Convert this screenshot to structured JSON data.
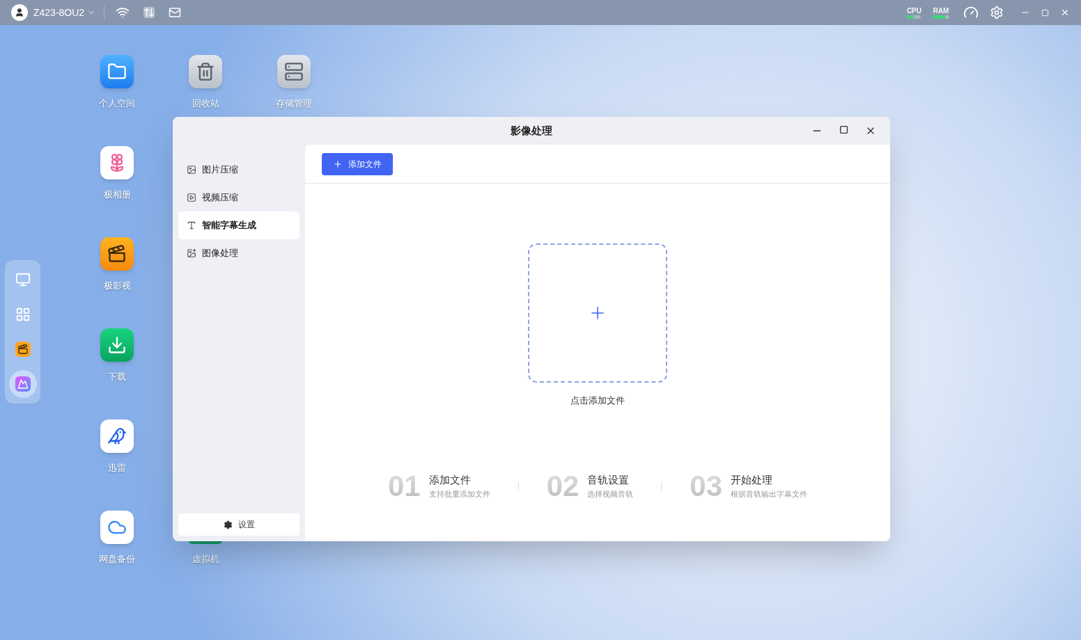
{
  "top_bar": {
    "device_name": "Z423-8OU2",
    "cpu_label": "CPU",
    "ram_label": "RAM",
    "cpu_meter": {
      "level": 0.5
    },
    "ram_meter": {
      "level": 0.8
    }
  },
  "desktop_icons": [
    {
      "label": "个人空间",
      "kind": "folder"
    },
    {
      "label": "回收站",
      "kind": "trash"
    },
    {
      "label": "存储管理",
      "kind": "storage"
    },
    {
      "label": "极相册",
      "kind": "photos"
    },
    {
      "label": "极影视",
      "kind": "video"
    },
    {
      "label": "下载",
      "kind": "download"
    },
    {
      "label": "迅雷",
      "kind": "bird"
    },
    {
      "label": "网盘备份",
      "kind": "cloud"
    },
    {
      "label": "虚拟机",
      "kind": "vm"
    }
  ],
  "dock": [
    {
      "kind": "monitor",
      "selected": false
    },
    {
      "kind": "grid",
      "selected": false
    },
    {
      "kind": "video",
      "selected": false
    },
    {
      "kind": "photo",
      "selected": true
    }
  ],
  "window": {
    "title": "影像处理",
    "sidebar": [
      {
        "label": "图片压缩",
        "kind": "image",
        "selected": false
      },
      {
        "label": "视频压缩",
        "kind": "video",
        "selected": false
      },
      {
        "label": "智能字幕生成",
        "kind": "subtitle",
        "selected": true
      },
      {
        "label": "图像处理",
        "kind": "sparkle",
        "selected": false
      }
    ],
    "settings_label": "设置",
    "add_button": "添加文件",
    "drop_zone_label": "点击添加文件",
    "steps": [
      {
        "number": "01",
        "title": "添加文件",
        "subtitle": "支持批量添加文件"
      },
      {
        "number": "02",
        "title": "音轨设置",
        "subtitle": "选择视频音轨"
      },
      {
        "number": "03",
        "title": "开始处理",
        "subtitle": "根据音轨输出字幕文件"
      }
    ]
  }
}
